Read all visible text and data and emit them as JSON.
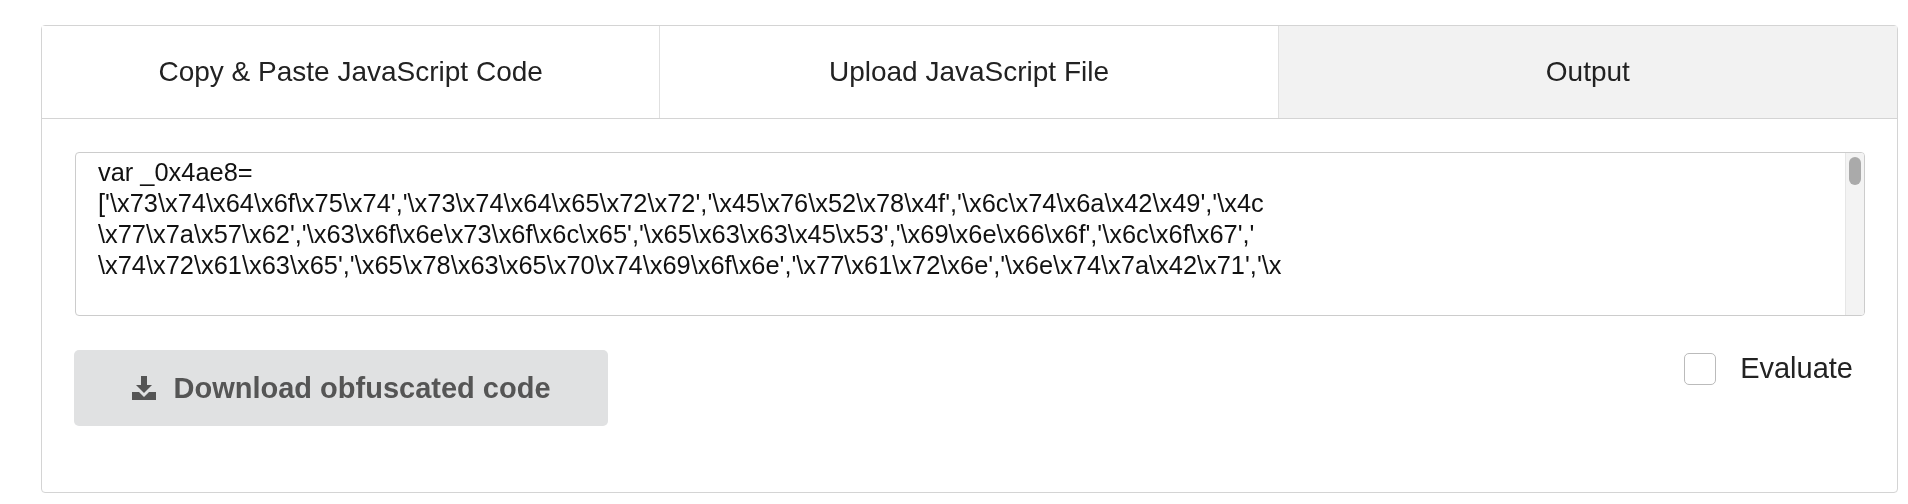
{
  "tabs": [
    {
      "label": "Copy & Paste JavaScript Code",
      "selected": false
    },
    {
      "label": "Upload JavaScript File",
      "selected": false
    },
    {
      "label": "Output",
      "selected": true
    }
  ],
  "output": {
    "lines": [
      "var _0x4ae8=",
      "['\\x73\\x74\\x64\\x6f\\x75\\x74','\\x73\\x74\\x64\\x65\\x72\\x72','\\x45\\x76\\x52\\x78\\x4f','\\x6c\\x74\\x6a\\x42\\x49','\\x4c",
      "\\x77\\x7a\\x57\\x62','\\x63\\x6f\\x6e\\x73\\x6f\\x6c\\x65','\\x65\\x63\\x63\\x45\\x53','\\x69\\x6e\\x66\\x6f','\\x6c\\x6f\\x67','",
      "\\x74\\x72\\x61\\x63\\x65','\\x65\\x78\\x63\\x65\\x70\\x74\\x69\\x6f\\x6e','\\x77\\x61\\x72\\x6e','\\x6e\\x74\\x7a\\x42\\x71','\\x"
    ]
  },
  "download_button": {
    "label": "Download obfuscated code",
    "disabled": true
  },
  "evaluate": {
    "label": "Evaluate",
    "checked": false
  }
}
